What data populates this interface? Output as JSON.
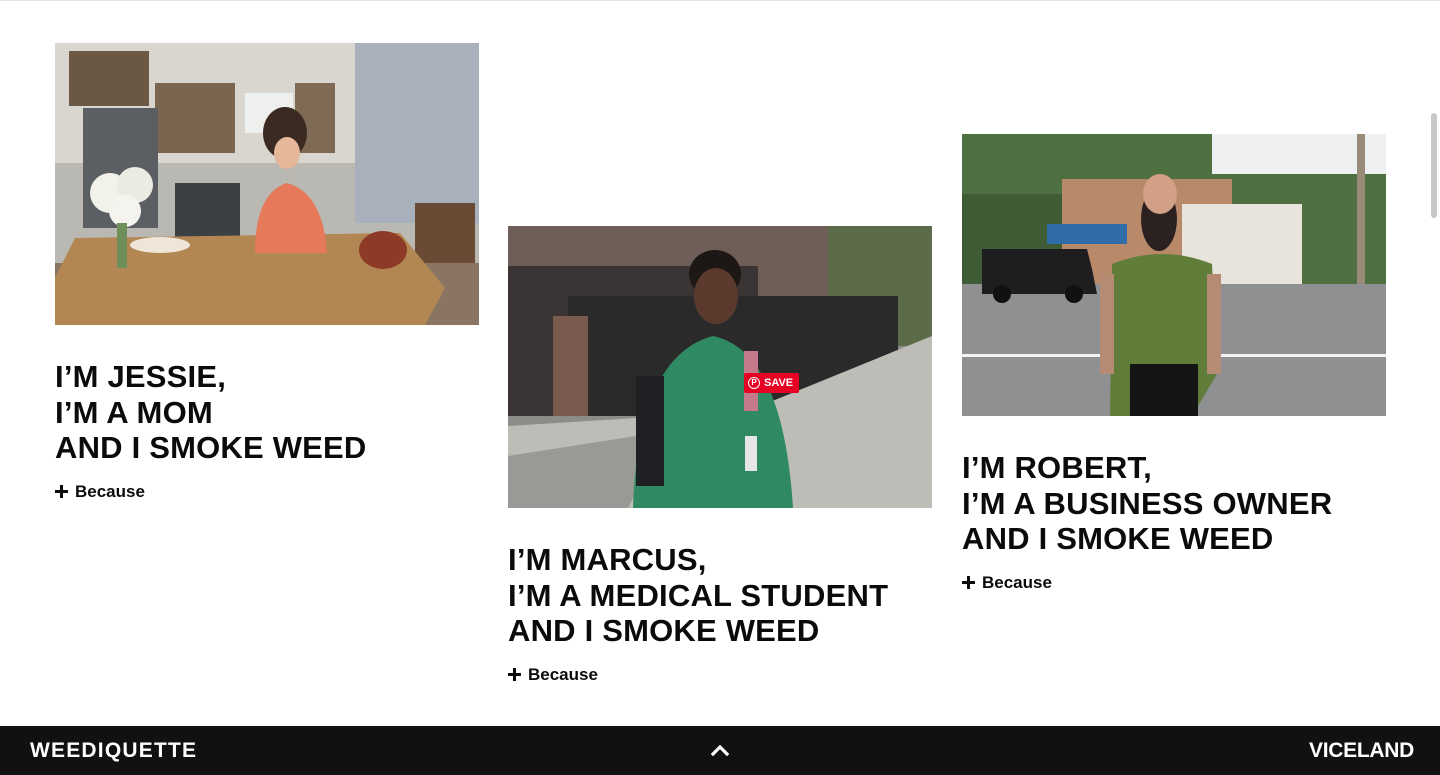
{
  "cards": [
    {
      "name": "jessie",
      "image_alt": "Woman laughing while leaning on a wooden kitchen island",
      "headline": [
        "I’M JESSIE,",
        "I’M A MOM",
        "AND I SMOKE WEED"
      ],
      "expand_label": "Because"
    },
    {
      "name": "marcus",
      "image_alt": "Medical student in green scrubs on a city sidewalk",
      "headline": [
        "I’M MARCUS,",
        "I’M A MEDICAL STUDENT",
        "AND I SMOKE WEED"
      ],
      "expand_label": "Because",
      "save_label": "SAVE"
    },
    {
      "name": "robert",
      "image_alt": "Bearded man in a green t-shirt standing on a street",
      "headline": [
        "I’M ROBERT,",
        "I’M A BUSINESS OWNER",
        "AND I SMOKE WEED"
      ],
      "expand_label": "Because"
    }
  ],
  "footer": {
    "brand": "WEEDIQUETTE",
    "network": "VICELAND",
    "back_to_top_icon": "chevron-up-icon"
  },
  "colors": {
    "footer_bg": "#111111",
    "text": "#0b0b0b",
    "pinterest_red": "#e60023"
  }
}
